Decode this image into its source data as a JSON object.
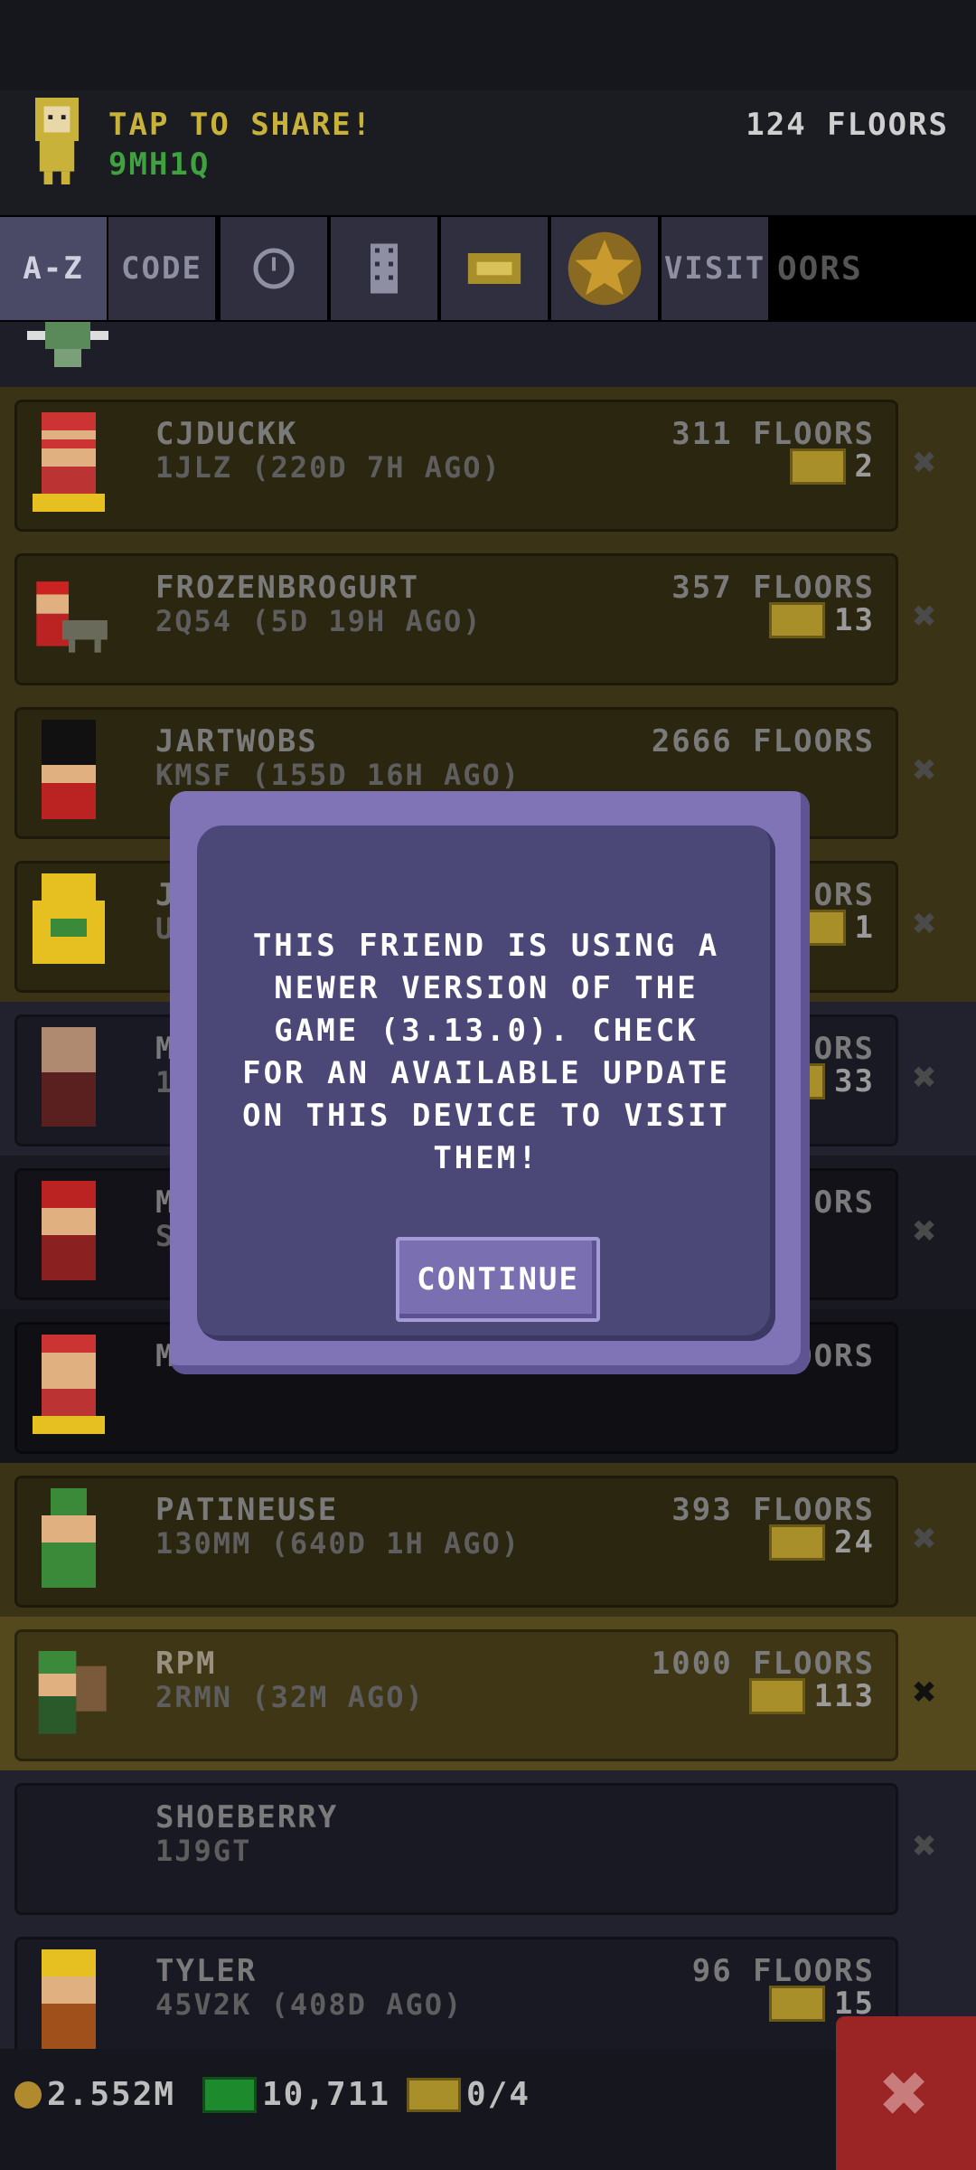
{
  "header": {
    "tap_label": "TAP TO SHARE!",
    "my_code": "9MH1Q",
    "my_floors": "124 FLOORS"
  },
  "tabs": [
    {
      "label": "A-Z",
      "icon": "",
      "active": true
    },
    {
      "label": "CODE",
      "icon": ""
    },
    {
      "label": "",
      "icon": "clock-icon"
    },
    {
      "label": "",
      "icon": "building-icon"
    },
    {
      "label": "",
      "icon": "ticket-icon"
    },
    {
      "label": "",
      "icon": "star-icon"
    },
    {
      "label": "VISIT",
      "icon": ""
    }
  ],
  "tabs_overflow_text": "OORS",
  "friends": [
    {
      "name": "CJDUCKK",
      "code": "1JLZ (220D 7H AGO)",
      "floors": "311 FLOORS",
      "bux": "2",
      "style": "gold"
    },
    {
      "name": "FROZENBROGURT",
      "code": "2Q54 (5D 19H AGO)",
      "floors": "357 FLOORS",
      "bux": "13",
      "style": "gold"
    },
    {
      "name": "JARTWOBS",
      "code": "KMSF (155D 16H AGO)",
      "floors": "2666 FLOORS",
      "bux": "",
      "style": "gold"
    },
    {
      "name": "J",
      "code": "U",
      "floors": "ORS",
      "bux": "1",
      "style": "gold"
    },
    {
      "name": "M",
      "code": "1",
      "floors": "ORS",
      "bux": "33",
      "style": "dark"
    },
    {
      "name": "M",
      "code": "S",
      "floors": "ORS",
      "bux": "",
      "style": "dark"
    },
    {
      "name": "M",
      "code": "",
      "floors": "OORS",
      "bux": "",
      "style": "dark"
    },
    {
      "name": "PATINEUSE",
      "code": "130MM (640D 1H AGO)",
      "floors": "393 FLOORS",
      "bux": "24",
      "style": "gold"
    },
    {
      "name": "RPM",
      "code": "2RMN (32M AGO)",
      "floors": "1000 FLOORS",
      "bux": "113",
      "style": "gold bright"
    },
    {
      "name": "SHOEBERRY",
      "code": "1J9GT",
      "floors": "",
      "bux": "",
      "style": "dark"
    },
    {
      "name": "TYLER",
      "code": "45V2K (408D AGO)",
      "floors": "96 FLOORS",
      "bux": "15",
      "style": "dark"
    }
  ],
  "dialog": {
    "message": "THIS FRIEND IS USING A NEWER VERSION OF THE GAME (3.13.0). CHECK FOR AN AVAILABLE UPDATE ON THIS DEVICE TO VISIT THEM!",
    "button": "CONTINUE"
  },
  "footer": {
    "coins": "2.552M",
    "bux": "10,711",
    "tickets": "0/4"
  },
  "colors": {
    "dialog_outer": "#8074b6",
    "dialog_inner": "#4b4878",
    "gold_row": "#3a3316",
    "close_button": "#9b2424"
  }
}
